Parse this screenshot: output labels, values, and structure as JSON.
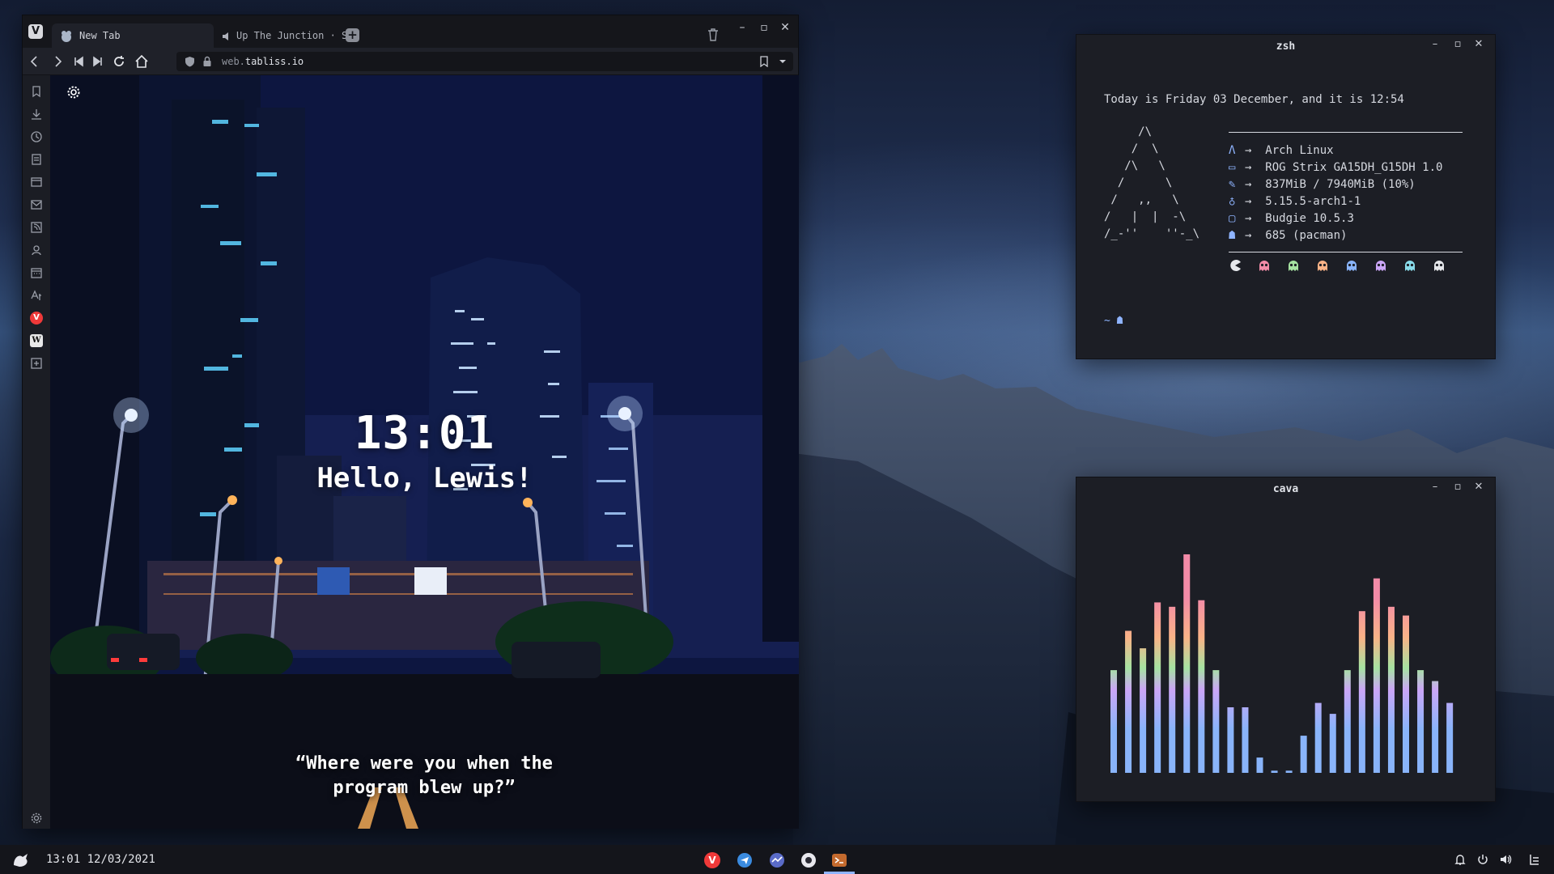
{
  "browser": {
    "tabs": [
      {
        "label": "New Tab",
        "active": true
      },
      {
        "label": "Up The Junction · Sq",
        "active": false
      }
    ],
    "url_prefix": "web.",
    "url_host": "tabliss.io",
    "content": {
      "clock": "13:01",
      "greeting": "Hello, Lewis!",
      "quote": "“Where were you when the program blew up?”"
    }
  },
  "zsh": {
    "title": "zsh",
    "date_line": "Today is Friday 03 December, and it is 12:54",
    "art": "     /\\\n    /  \\\n   /\\   \\\n  /      \\\n /   ,,   \\\n/   |  |  -\\\n/_-''    ''-_\\",
    "info": [
      {
        "icon": "arch-icon",
        "glyph": "Λ",
        "value": "Arch Linux"
      },
      {
        "icon": "laptop-icon",
        "glyph": "▭",
        "value": "ROG Strix GA15DH_G15DH 1.0"
      },
      {
        "icon": "memory-icon",
        "glyph": "✎",
        "value": "837MiB / 7940MiB (10%)"
      },
      {
        "icon": "kernel-icon",
        "glyph": "♁",
        "value": "5.15.5-arch1-1"
      },
      {
        "icon": "window-icon",
        "glyph": "▢",
        "value": "Budgie 10.5.3"
      },
      {
        "icon": "package-icon",
        "glyph": "☗",
        "value": "685 (pacman)"
      }
    ],
    "arrow": "→",
    "prompt": "~ ☗",
    "ghost_colors": [
      "#e5e7eb",
      "#f38ba8",
      "#a6e3a1",
      "#fab387",
      "#89b4fa",
      "#cba6f7",
      "#89dceb",
      "#e5e7eb"
    ]
  },
  "cava": {
    "title": "cava",
    "levels": [
      0.47,
      0.65,
      0.57,
      0.78,
      0.76,
      1.0,
      0.79,
      0.47,
      0.3,
      0.3,
      0.07,
      0.01,
      0.01,
      0.17,
      0.32,
      0.27,
      0.47,
      0.74,
      0.89,
      0.76,
      0.72,
      0.47,
      0.42,
      0.32
    ]
  },
  "panel": {
    "time": "13:01",
    "date": "12/03/2021"
  },
  "colors": {
    "accent": "#8fb4ff",
    "vivaldi": "#ef3939"
  }
}
